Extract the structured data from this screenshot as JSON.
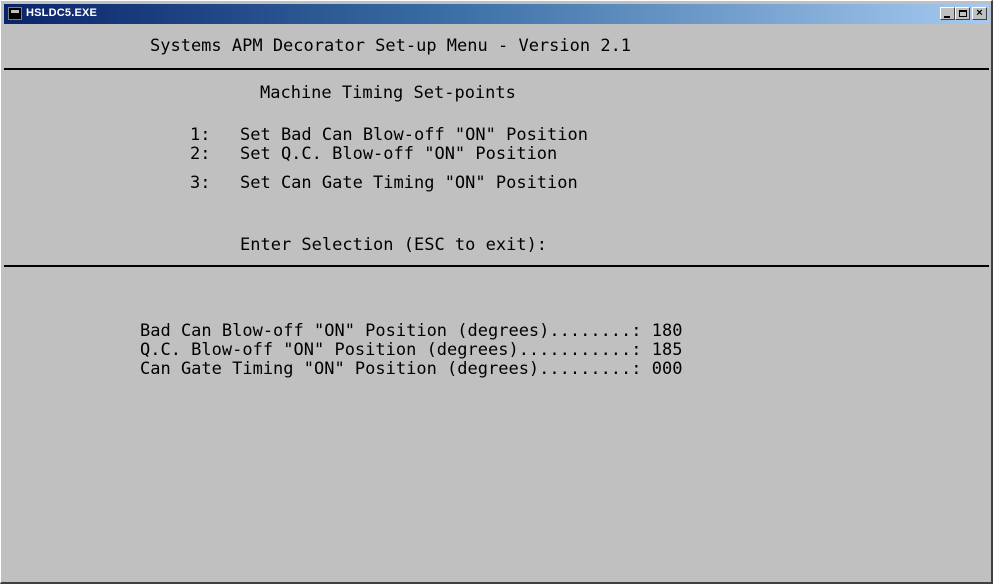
{
  "window": {
    "title": "HSLDC5.EXE",
    "icon": "ms-dos-icon",
    "controls": {
      "minimize": "minimize-icon",
      "maximize": "maximize-icon",
      "close": "close-icon"
    }
  },
  "console": {
    "header": "Systems APM Decorator Set-up Menu - Version 2.1",
    "menu": {
      "title": "Machine Timing Set-points",
      "items": [
        {
          "key": "1:",
          "label": "Set Bad Can Blow-off \"ON\" Position"
        },
        {
          "key": "2:",
          "label": "Set Q.C. Blow-off \"ON\" Position"
        },
        {
          "key": "3:",
          "label": "Set Can Gate Timing \"ON\" Position"
        }
      ],
      "prompt": "Enter Selection (ESC to exit):"
    },
    "values": [
      {
        "label": "Bad Can Blow-off \"ON\" Position (degrees)........: ",
        "value": "180"
      },
      {
        "label": "Q.C. Blow-off \"ON\" Position (degrees)...........: ",
        "value": "185"
      },
      {
        "label": "Can Gate Timing \"ON\" Position (degrees).........: ",
        "value": "000"
      }
    ]
  }
}
